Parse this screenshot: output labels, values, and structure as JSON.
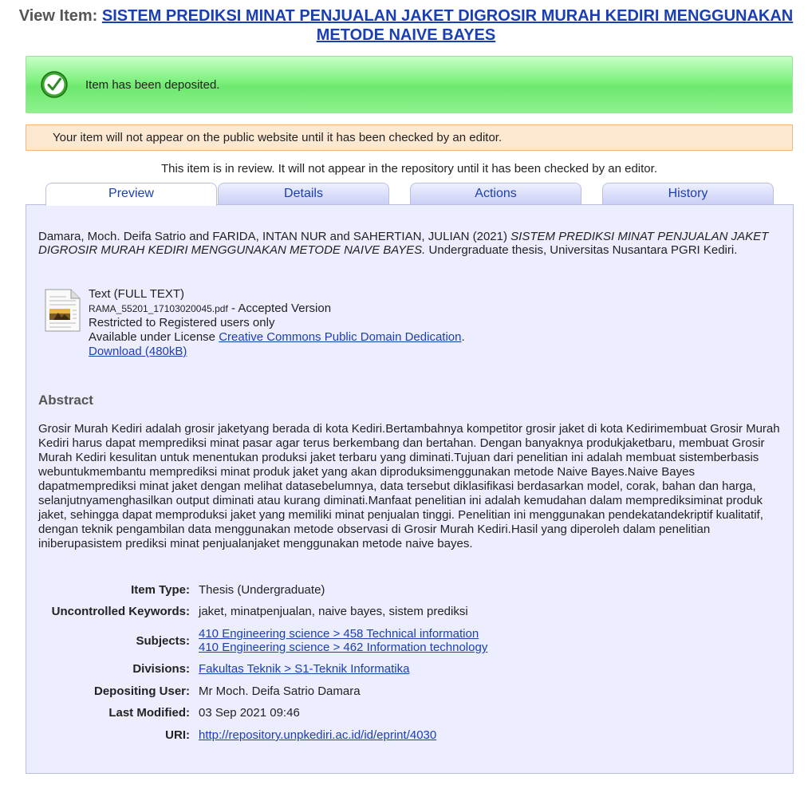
{
  "header": {
    "label": "View Item:",
    "title": "SISTEM PREDIKSI MINAT PENJUALAN JAKET DIGROSIR MURAH KEDIRI MENGGUNAKAN METODE NAIVE BAYES"
  },
  "messages": {
    "success": "Item has been deposited.",
    "warning": "Your item will not appear on the public website until it has been checked by an editor.",
    "review_note": "This item is in review. It will not appear in the repository until it has been checked by an editor."
  },
  "tabs": [
    {
      "label": "Preview"
    },
    {
      "label": "Details"
    },
    {
      "label": "Actions"
    },
    {
      "label": "History"
    }
  ],
  "citation": {
    "authors": "Damara, Moch. Deifa Satrio and FARIDA, INTAN NUR and SAHERTIAN, JULIAN (2021)",
    "title": "SISTEM PREDIKSI MINAT PENJUALAN JAKET DIGROSIR MURAH KEDIRI MENGGUNAKAN METODE NAIVE BAYES.",
    "rest": "Undergraduate thesis, Universitas Nusantara PGRI Kediri."
  },
  "document": {
    "type": "Text (FULL TEXT)",
    "filename": "RAMA_55201_17103020045.pdf",
    "version": "- Accepted Version",
    "restriction": "Restricted to Registered users only",
    "license_prefix": "Available under License",
    "license": "Creative Commons Public Domain Dedication",
    "license_suffix": ".",
    "download": "Download (480kB)"
  },
  "abstract": {
    "heading": "Abstract",
    "text": "Grosir Murah Kediri adalah grosir jaketyang berada di kota Kediri.Bertambahnya kompetitor grosir jaket di kota Kedirimembuat Grosir Murah Kediri harus dapat memprediksi minat pasar agar terus berkembang dan bertahan. Dengan banyaknya produkjaketbaru, membuat Grosir Murah Kediri kesulitan untuk menentukan produksi jaket terbaru yang diminati.Tujuan dari penelitian ini adalah membuat sistemberbasis webuntukmembantu memprediksi minat produk jaket yang akan diproduksimenggunakan metode Naive Bayes.Naive Bayes dapatmemprediksi minat jaket dengan melihat datasebelumnya, data tersebut diklasifikasi berdasarkan model, corak, bahan dan harga, selanjutnyamenghasilkan output diminati atau kurang diminati.Manfaat penelitian ini adalah kemudahan dalam memprediksiminat produk jaket, sehingga dapat memproduksi jaket yang memiliki minat penjualan tinggi. Penelitian ini menggunakan pendekatandekriptif kualitatif, dengan teknik pengambilan data menggunakan metode observasi di Grosir Murah Kediri.Hasil yang diperoleh dalam penelitian iniberupasistem prediksi minat penjualanjaket menggunakan metode naive bayes."
  },
  "metadata": {
    "item_type": {
      "label": "Item Type:",
      "value": "Thesis (Undergraduate)"
    },
    "keywords": {
      "label": "Uncontrolled Keywords:",
      "value": "jaket, minatpenjualan, naive bayes, sistem prediksi"
    },
    "subjects": {
      "label": "Subjects:",
      "values": [
        "410 Engineering science > 458 Technical information",
        "410 Engineering science > 462 Information technology"
      ]
    },
    "divisions": {
      "label": "Divisions:",
      "value": "Fakultas Teknik > S1-Teknik Informatika"
    },
    "depositing_user": {
      "label": "Depositing User:",
      "value": "Mr Moch. Deifa Satrio Damara"
    },
    "last_modified": {
      "label": "Last Modified:",
      "value": "03 Sep 2021 09:46"
    },
    "uri": {
      "label": "URI:",
      "value": "http://repository.unpkediri.ac.id/id/eprint/4030"
    }
  }
}
